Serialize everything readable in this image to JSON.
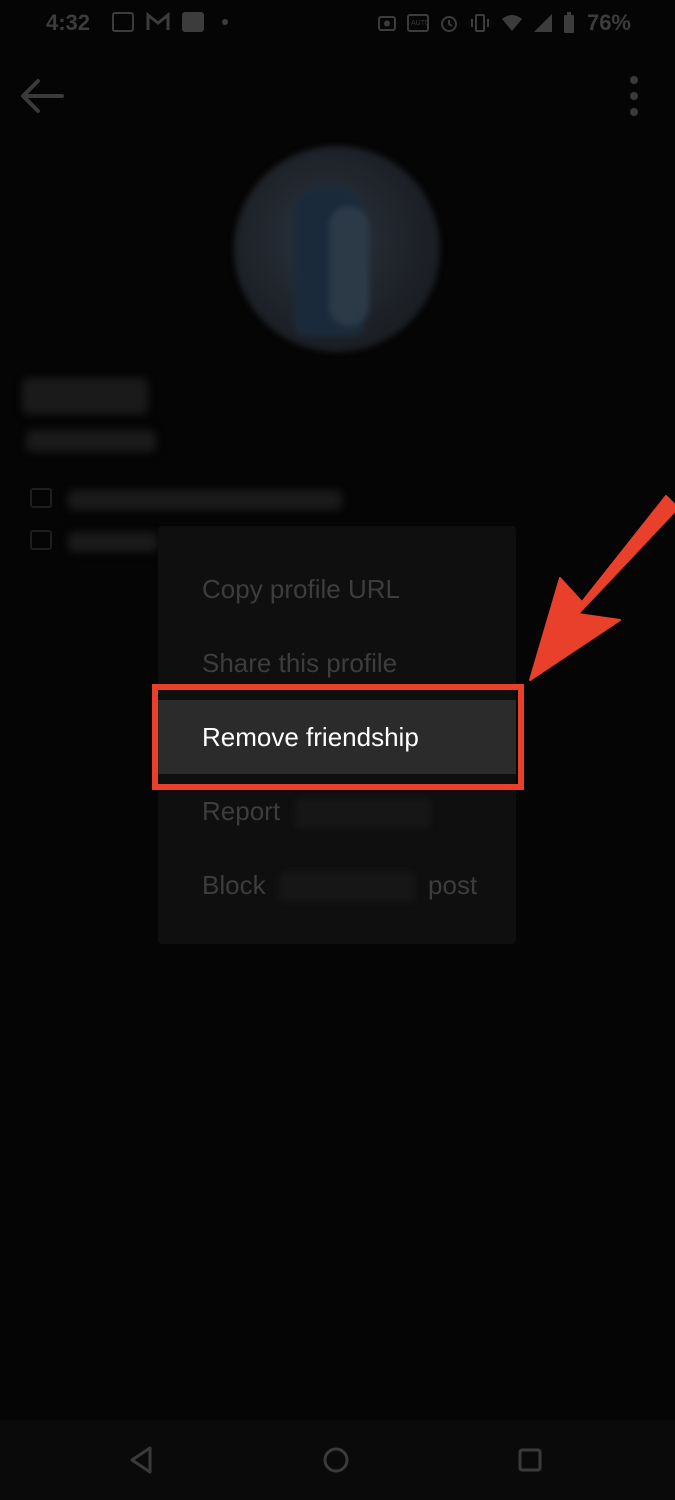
{
  "status_bar": {
    "time": "4:32",
    "battery": "76%",
    "left_icons": [
      "image-icon",
      "gmail-icon",
      "linkedin-icon",
      "dot-icon"
    ],
    "right_icons": [
      "screenshot-icon",
      "auto-brightness-icon",
      "alarm-icon",
      "vibrate-icon",
      "wifi-icon",
      "signal-icon",
      "battery-icon"
    ]
  },
  "app_bar": {
    "back_icon": "arrow-left-icon",
    "more_icon": "more-vert-icon"
  },
  "profile": {
    "name": "",
    "handle": ""
  },
  "menu": {
    "items": [
      {
        "label": "Copy profile URL"
      },
      {
        "label": "Share this profile"
      },
      {
        "label": "Remove friendship",
        "highlighted": true
      },
      {
        "label": "Report"
      },
      {
        "label_prefix": "Block",
        "label_suffix": "post"
      }
    ]
  },
  "annotation": {
    "highlight_color": "#e8402a"
  },
  "nav_bar": {
    "icons": [
      "back-triangle-icon",
      "home-circle-icon",
      "recents-square-icon"
    ]
  }
}
